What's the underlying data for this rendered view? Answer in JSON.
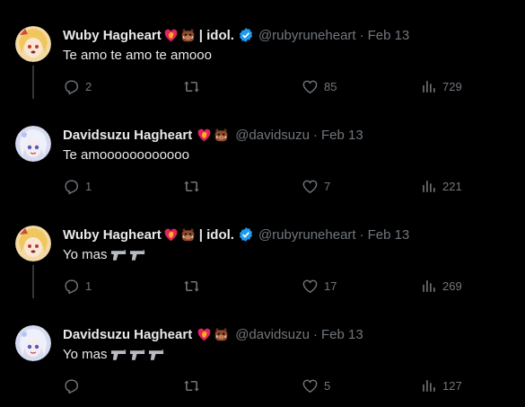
{
  "tweets": [
    {
      "name": "Wuby Hagheart",
      "idol": "| idol.",
      "verified": true,
      "handle": "@rubyruneheart",
      "sep": "·",
      "date": "Feb 13",
      "text": "Te amo te amo te amooo",
      "guns": 0,
      "avatar": "avatar-ruby",
      "replies": "2",
      "retweets": "",
      "likes": "85",
      "views": "729"
    },
    {
      "name": "Davidsuzu Hagheart",
      "idol": "",
      "verified": false,
      "handle": "@davidsuzu",
      "sep": "·",
      "date": "Feb 13",
      "text": "Te amoooooooooooo",
      "guns": 0,
      "avatar": "avatar-david",
      "replies": "1",
      "retweets": "",
      "likes": "7",
      "views": "221"
    },
    {
      "name": "Wuby Hagheart",
      "idol": "| idol.",
      "verified": true,
      "handle": "@rubyruneheart",
      "sep": "·",
      "date": "Feb 13",
      "text": "Yo mas",
      "guns": 2,
      "avatar": "avatar-ruby",
      "replies": "1",
      "retweets": "",
      "likes": "17",
      "views": "269"
    },
    {
      "name": "Davidsuzu Hagheart",
      "idol": "",
      "verified": false,
      "handle": "@davidsuzu",
      "sep": "·",
      "date": "Feb 13",
      "text": "Yo mas",
      "guns": 3,
      "avatar": "avatar-david",
      "replies": "",
      "retweets": "",
      "likes": "5",
      "views": "127"
    }
  ],
  "icons": {
    "reply": "reply-icon",
    "retweet": "retweet-icon",
    "like": "heart-icon",
    "views": "views-icon",
    "verified": "verified-badge-icon",
    "emoji_heart": "heart-on-fire-emoji",
    "emoji_boar": "boar-emoji",
    "gun": "water-pistol-emoji"
  },
  "colors": {
    "background": "#000000",
    "text": "#e7e9ea",
    "muted": "#71767b",
    "verified": "#1d9bf0",
    "thread_line": "#333639"
  }
}
